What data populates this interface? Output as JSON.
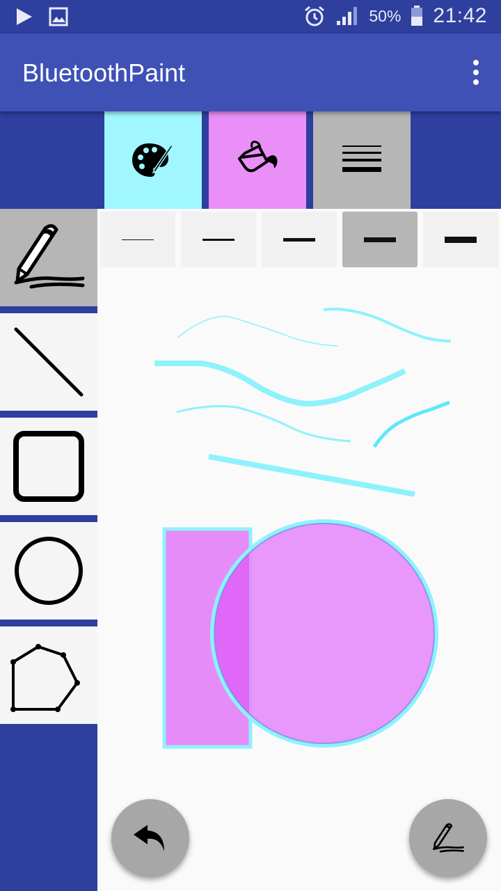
{
  "status_bar": {
    "battery_percent": "50%",
    "time": "21:42",
    "icons": [
      "play-store-icon",
      "gallery-icon",
      "alarm-icon",
      "signal-icon",
      "battery-icon"
    ]
  },
  "app_bar": {
    "title": "BluetoothPaint",
    "overflow_icon": "more-vert-icon"
  },
  "top_tools": [
    {
      "id": "color-palette",
      "icon": "palette-icon",
      "color": "#a0f7ff"
    },
    {
      "id": "fill-color",
      "icon": "paint-bucket-icon",
      "color": "#ea8ff8"
    },
    {
      "id": "stroke-width",
      "icon": "stroke-width-icon",
      "color": "#b6b6b6"
    }
  ],
  "shape_tools": [
    {
      "id": "freehand",
      "icon": "pen-icon",
      "selected": true
    },
    {
      "id": "line",
      "icon": "line-icon",
      "selected": false
    },
    {
      "id": "rectangle",
      "icon": "rectangle-icon",
      "selected": false
    },
    {
      "id": "ellipse",
      "icon": "circle-icon",
      "selected": false
    },
    {
      "id": "polygon",
      "icon": "polygon-icon",
      "selected": false
    }
  ],
  "stroke_widths": {
    "selected_index": 3,
    "options": [
      1,
      3,
      5,
      7,
      9
    ]
  },
  "canvas": {
    "stroke_color": "#7ff0fb",
    "fill_color": "#e68cf9",
    "shapes": [
      "freehand-stroke",
      "freehand-stroke",
      "freehand-stroke",
      "freehand-stroke",
      "freehand-stroke",
      "line",
      "rectangle",
      "circle"
    ]
  },
  "fabs": [
    {
      "id": "undo",
      "icon": "undo-icon"
    },
    {
      "id": "draw-mode",
      "icon": "pen-icon"
    }
  ],
  "colors": {
    "primary": "#3f51b5",
    "primary_dark": "#2e3f9e",
    "selected_gray": "#b6b6b6",
    "cyan_accent": "#a0f7ff",
    "magenta_accent": "#ea8ff8"
  }
}
